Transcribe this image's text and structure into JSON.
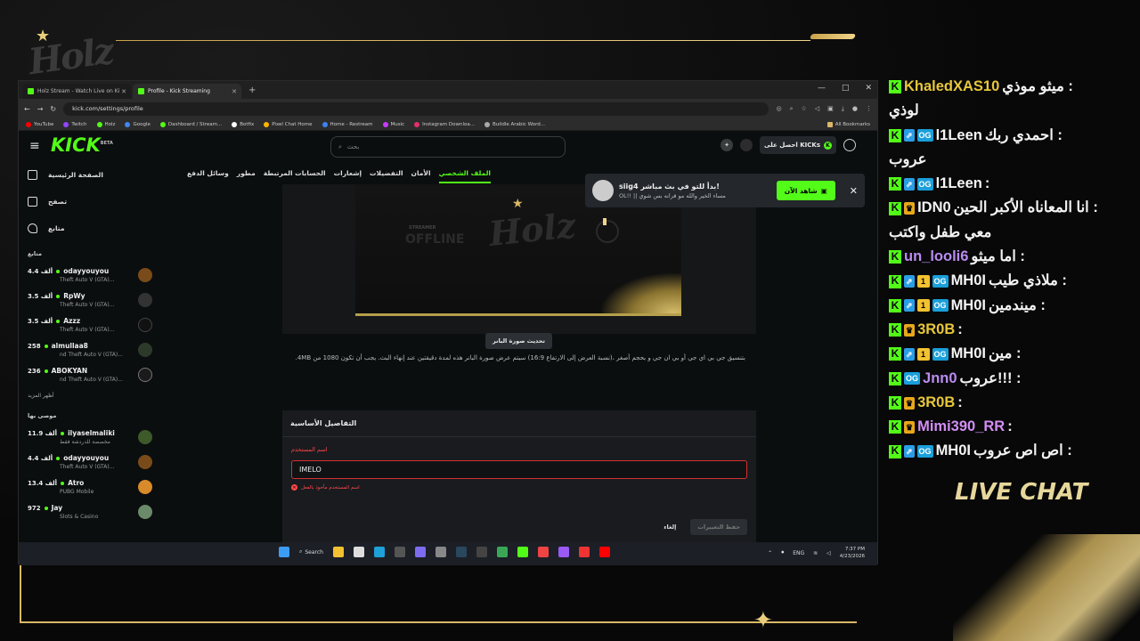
{
  "browser": {
    "tabs": [
      {
        "label": "Holz Stream - Watch Live on Ki",
        "active": false
      },
      {
        "label": "Profile - Kick Streaming",
        "active": true
      }
    ],
    "url": "kick.com/settings/profile",
    "bookmarks": [
      "YouTube",
      "Twitch",
      "Holz",
      "Google",
      "Dashboard / Stream...",
      "Botfix",
      "Pixel Chat Home",
      "Home - Restream",
      "Music",
      "Instagram Downloa...",
      "Buildle Arabic Word..."
    ],
    "all_bookmarks": "All Bookmarks"
  },
  "kick": {
    "logo": "KICK",
    "logo_badge": "BETA",
    "search_placeholder": "بحث",
    "get_kicks": "احصل على KICKs",
    "nav": [
      {
        "label": "الصفحة الرئيسية",
        "icon": "home-icon"
      },
      {
        "label": "تصفح",
        "icon": "browse-icon"
      },
      {
        "label": "متابع",
        "icon": "heart-icon"
      }
    ],
    "following_header": "متابع",
    "following": [
      {
        "name": "odayyouyou",
        "viewers": "4.4 ألف",
        "game": "Theft Auto V (GTA)..."
      },
      {
        "name": "RpWy",
        "viewers": "3.5 ألف",
        "game": "Theft Auto V (GTA)..."
      },
      {
        "name": "Azzz",
        "viewers": "3.5 ألف",
        "game": "Theft Auto V (GTA)..."
      },
      {
        "name": "almullaa8",
        "viewers": "258",
        "game": "nd Theft Auto V (GTA)..."
      },
      {
        "name": "ABOKYAN",
        "viewers": "236",
        "game": "nd Theft Auto V (GTA)..."
      }
    ],
    "show_more": "أظهر المزيد",
    "recommended_header": "موصى بها",
    "recommended": [
      {
        "name": "ilyaselmaliki",
        "viewers": "11.9 ألف",
        "game": "مخصصة للدردشة فقط"
      },
      {
        "name": "odayyouyou",
        "viewers": "4.4 ألف",
        "game": "Theft Auto V (GTA)..."
      },
      {
        "name": "Atro",
        "viewers": "13.4 ألف",
        "game": "PUBG Mobile"
      },
      {
        "name": "Jay",
        "viewers": "972",
        "game": "Slots & Casino"
      }
    ],
    "settings_tabs": [
      "الملف الشخصي",
      "الأمان",
      "التفضيلات",
      "إشعارات",
      "الحسابات المرتبطة",
      "مطور",
      "وسائل الدفع"
    ],
    "banner": {
      "streamer_text": "STREAMER",
      "offline_text": "OFFLINE",
      "brand_text": "Holz",
      "update_button": "تحديث صورة البانر",
      "hint": "بتنسيق جي بي اي جي أو بي ان جي و بحجم أصغر ،(نسبة العرض إلى الارتفاع 16:9) سيتم عرض صورة البانر هذه لمدة دقيقتين عند إنهاء البث. يجب أن تكون 1080 من 4MB."
    },
    "details": {
      "title": "التفاصيل الأساسية",
      "username_label": "اسم المستخدم",
      "username_value": "IMELO",
      "error": "اسم المستخدم مأخوذ بالفعل",
      "cancel": "إلغاء",
      "save": "حفظ التغييرات"
    },
    "notification": {
      "title": "siig4 بدأ للتو في بث مباشر!",
      "subtitle": "OL!! || مساء الخير والله مو قرانه بس شوي",
      "watch_now": "شاهد الآن"
    }
  },
  "taskbar": {
    "search": "Search",
    "lang": "ENG",
    "time": "7:37 PM",
    "date": "4/23/2026"
  },
  "chat": {
    "title": "LIVE CHAT",
    "messages": [
      {
        "user": "KhaledXAS10",
        "user_color": "#e7c73b",
        "badges": [],
        "text": "ميثو موذي :"
      },
      {
        "user": "",
        "user_color": "#f5f5f5",
        "badges": [],
        "text": "لوذي",
        "continuation": true
      },
      {
        "user": "l1Leen",
        "user_color": "#f5f5f5",
        "badges": [
          "sub",
          "og"
        ],
        "text": "احمدي ربك :"
      },
      {
        "user": "",
        "user_color": "#f5f5f5",
        "badges": [],
        "text": "عروب",
        "continuation": true
      },
      {
        "user": "l1Leen",
        "user_color": "#f5f5f5",
        "badges": [
          "sub",
          "og"
        ],
        "text": ":"
      },
      {
        "user": "IDN0",
        "user_color": "#f5f5f5",
        "badges": [
          "vip"
        ],
        "text": "انا المعاناه الأكبر الحين :"
      },
      {
        "user": "",
        "user_color": "#f5f5f5",
        "badges": [],
        "text": "معي طفل واكتب",
        "continuation": true
      },
      {
        "user": "un_looli6",
        "user_color": "#b98cf0",
        "badges": [],
        "text": "اما ميثو :"
      },
      {
        "user": "MH0I",
        "user_color": "#f5f5f5",
        "badges": [
          "sub",
          "num",
          "og"
        ],
        "text": "ملاذي طيب :"
      },
      {
        "user": "MH0I",
        "user_color": "#f5f5f5",
        "badges": [
          "sub",
          "num",
          "og"
        ],
        "text": "ميندمين :"
      },
      {
        "user": "3R0B",
        "user_color": "#e7c73b",
        "badges": [
          "vip"
        ],
        "text": ":"
      },
      {
        "user": "MH0I",
        "user_color": "#f5f5f5",
        "badges": [
          "sub",
          "num",
          "og"
        ],
        "text": "مين :"
      },
      {
        "user": "Jnn0",
        "user_color": "#b98cf0",
        "badges": [
          "og"
        ],
        "text": "عروب!!! :"
      },
      {
        "user": "3R0B",
        "user_color": "#e7c73b",
        "badges": [
          "vip"
        ],
        "text": ":"
      },
      {
        "user": "Mimi390_RR",
        "user_color": "#d38ef5",
        "badges": [
          "vip"
        ],
        "text": ":"
      },
      {
        "user": "MH0I",
        "user_color": "#f5f5f5",
        "badges": [
          "sub",
          "og"
        ],
        "text": "اص اص عروب :"
      }
    ]
  },
  "colors": {
    "kick_green": "#53fc18",
    "gold": "#d9b866",
    "error_red": "#ff4a4a"
  }
}
